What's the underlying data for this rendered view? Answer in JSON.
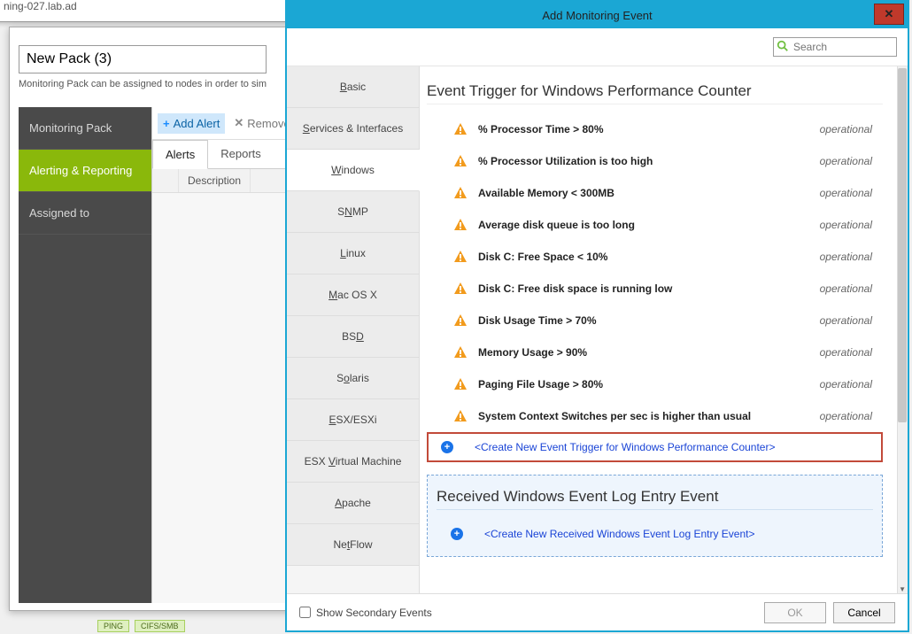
{
  "bg_tab": "ning-027.lab.ad",
  "pack_name": "New Pack (3)",
  "pack_hint": "Monitoring Pack can be assigned to nodes in order to sim",
  "sidebar": {
    "items": [
      {
        "label": "Monitoring Pack"
      },
      {
        "label": "Alerting & Reporting"
      },
      {
        "label": "Assigned to"
      }
    ]
  },
  "toolbar": {
    "add": "Add Alert",
    "remove": "Remove"
  },
  "tabs": {
    "alerts": "Alerts",
    "reports": "Reports"
  },
  "grid": {
    "col_description": "Description"
  },
  "status_pills": [
    "PING",
    "CIFS/SMB"
  ],
  "modal": {
    "title": "Add Monitoring Event",
    "search_placeholder": "Search",
    "categories": [
      {
        "pre": "",
        "u": "B",
        "post": "asic"
      },
      {
        "pre": "",
        "u": "S",
        "post": "ervices & Interfaces"
      },
      {
        "pre": "",
        "u": "W",
        "post": "indows"
      },
      {
        "pre": "S",
        "u": "N",
        "post": "MP"
      },
      {
        "pre": "",
        "u": "L",
        "post": "inux"
      },
      {
        "pre": "",
        "u": "M",
        "post": "ac OS X"
      },
      {
        "pre": "BS",
        "u": "D",
        "post": ""
      },
      {
        "pre": "S",
        "u": "o",
        "post": "laris"
      },
      {
        "pre": "",
        "u": "E",
        "post": "SX/ESXi"
      },
      {
        "pre": "ESX ",
        "u": "V",
        "post": "irtual Machine"
      },
      {
        "pre": "",
        "u": "A",
        "post": "pache"
      },
      {
        "pre": "Ne",
        "u": "t",
        "post": "Flow"
      }
    ],
    "section1_title": "Event Trigger for Windows Performance Counter",
    "events": [
      {
        "label": "% Processor Time > 80%",
        "type": "operational"
      },
      {
        "label": "% Processor Utilization is too high",
        "type": "operational"
      },
      {
        "label": "Available Memory < 300MB",
        "type": "operational"
      },
      {
        "label": "Average disk queue is too long",
        "type": "operational"
      },
      {
        "label": "Disk C: Free Space < 10%",
        "type": "operational"
      },
      {
        "label": "Disk C: Free disk space is running low",
        "type": "operational"
      },
      {
        "label": "Disk Usage Time > 70%",
        "type": "operational"
      },
      {
        "label": "Memory Usage > 90%",
        "type": "operational"
      },
      {
        "label": "Paging File Usage > 80%",
        "type": "operational"
      },
      {
        "label": "System Context Switches per sec is higher than usual",
        "type": "operational"
      }
    ],
    "create1": "<Create New Event Trigger for Windows Performance Counter>",
    "section2_title": "Received Windows Event Log Entry Event",
    "create2": "<Create New Received Windows Event Log Entry Event>",
    "show_secondary": "Show Secondary Events",
    "ok": "OK",
    "cancel": "Cancel"
  }
}
